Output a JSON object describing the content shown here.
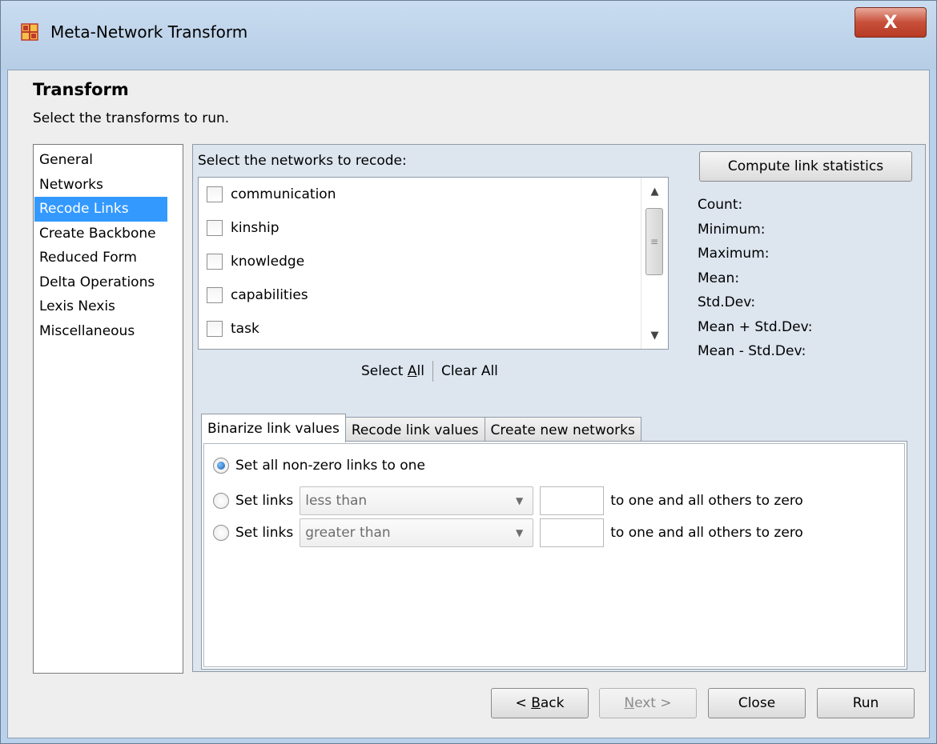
{
  "window": {
    "title": "Meta-Network Transform",
    "close_glyph": "X"
  },
  "header": {
    "title": "Transform",
    "subtitle": "Select the transforms to run."
  },
  "sidebar": {
    "items": [
      {
        "label": "General"
      },
      {
        "label": "Networks"
      },
      {
        "label": "Recode Links",
        "selected": true
      },
      {
        "label": "Create Backbone"
      },
      {
        "label": "Reduced Form"
      },
      {
        "label": "Delta Operations"
      },
      {
        "label": "Lexis Nexis"
      },
      {
        "label": "Miscellaneous"
      }
    ]
  },
  "networks": {
    "prompt": "Select the networks to recode:",
    "items": [
      {
        "label": "communication",
        "checked": false
      },
      {
        "label": "kinship",
        "checked": false
      },
      {
        "label": "knowledge",
        "checked": false
      },
      {
        "label": "capabilities",
        "checked": false
      },
      {
        "label": "task",
        "checked": false
      }
    ],
    "select_all_prefix": "Select ",
    "select_all_mnemonic": "A",
    "select_all_suffix": "ll",
    "clear_all": "Clear All"
  },
  "stats": {
    "compute_button": "Compute link statistics",
    "labels": [
      "Count:",
      "Minimum:",
      "Maximum:",
      "Mean:",
      "Std.Dev:",
      "Mean + Std.Dev:",
      "Mean - Std.Dev:"
    ]
  },
  "tabs": [
    {
      "label": "Binarize link values",
      "active": true
    },
    {
      "label": "Recode link values",
      "active": false
    },
    {
      "label": "Create new networks",
      "active": false
    }
  ],
  "binarize": {
    "option1": "Set all non-zero links to one",
    "option2_label": "Set links",
    "option2_combo": "less than",
    "option2_value": "",
    "option2_suffix": "to one and all others to zero",
    "option3_label": "Set links",
    "option3_combo": "greater than",
    "option3_value": "",
    "option3_suffix": "to one and all others to zero",
    "selected_option": 1
  },
  "footer": {
    "back_prefix": "< ",
    "back_mnemonic": "B",
    "back_suffix": "ack",
    "next_mnemonic": "N",
    "next_suffix": "ext >",
    "close": "Close",
    "run": "Run"
  },
  "colors": {
    "selection": "#3399ff",
    "panel": "#dde5ef",
    "frame": "#b9d1ea"
  }
}
